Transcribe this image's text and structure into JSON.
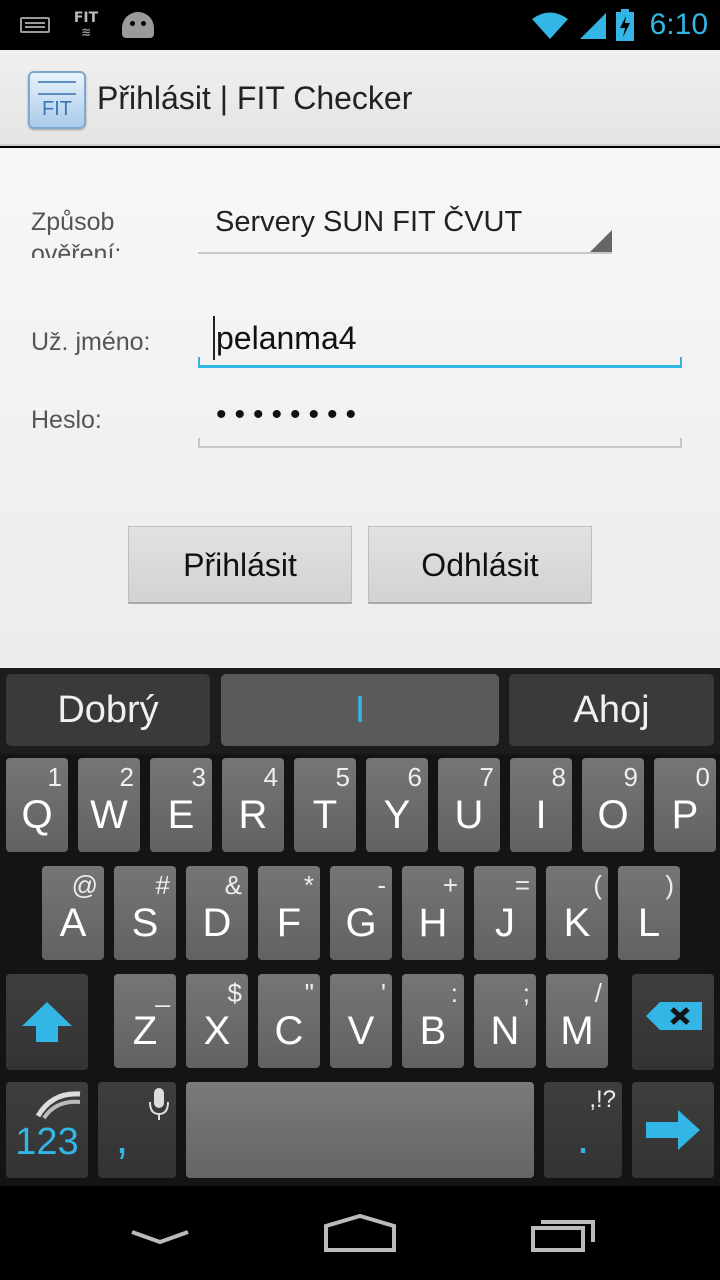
{
  "status_bar": {
    "time": "6:10",
    "notif_fit_label": "FIT",
    "icons": [
      "keyboard-icon",
      "fit-notification-icon",
      "android-debug-icon",
      "wifi-icon",
      "signal-icon",
      "battery-charging-icon"
    ]
  },
  "action_bar": {
    "app_icon_label": "FIT",
    "title": "Přihlásit | FIT Checker"
  },
  "form": {
    "auth_label": "Způsob ověření:",
    "auth_value": "Servery SUN FIT ČVUT",
    "username_label": "Už. jméno:",
    "username_value": "pelanma4",
    "password_label": "Heslo:",
    "password_value": "••••••••",
    "login_button": "Přihlásit",
    "logout_button": "Odhlásit"
  },
  "keyboard": {
    "suggestions": [
      "Dobrý",
      "I",
      "Ahoj"
    ],
    "row1": [
      {
        "key": "Q",
        "alt": "1"
      },
      {
        "key": "W",
        "alt": "2"
      },
      {
        "key": "E",
        "alt": "3"
      },
      {
        "key": "R",
        "alt": "4"
      },
      {
        "key": "T",
        "alt": "5"
      },
      {
        "key": "Y",
        "alt": "6"
      },
      {
        "key": "U",
        "alt": "7"
      },
      {
        "key": "I",
        "alt": "8"
      },
      {
        "key": "O",
        "alt": "9"
      },
      {
        "key": "P",
        "alt": "0"
      }
    ],
    "row2": [
      {
        "key": "A",
        "alt": "@"
      },
      {
        "key": "S",
        "alt": "#"
      },
      {
        "key": "D",
        "alt": "&"
      },
      {
        "key": "F",
        "alt": "*"
      },
      {
        "key": "G",
        "alt": "-"
      },
      {
        "key": "H",
        "alt": "+"
      },
      {
        "key": "J",
        "alt": "="
      },
      {
        "key": "K",
        "alt": "("
      },
      {
        "key": "L",
        "alt": ")"
      }
    ],
    "row3": [
      {
        "key": "Z",
        "alt": "_"
      },
      {
        "key": "X",
        "alt": "$"
      },
      {
        "key": "C",
        "alt": "\""
      },
      {
        "key": "V",
        "alt": "'"
      },
      {
        "key": "B",
        "alt": ":"
      },
      {
        "key": "N",
        "alt": ";"
      },
      {
        "key": "M",
        "alt": "/"
      }
    ],
    "numbers_key": "123",
    "comma_key": ",",
    "period_key": ".",
    "period_alt": ",!?",
    "accent_color": "#33b5e5"
  },
  "nav_bar": {
    "buttons": [
      "back-icon",
      "home-icon",
      "recent-apps-icon"
    ]
  }
}
